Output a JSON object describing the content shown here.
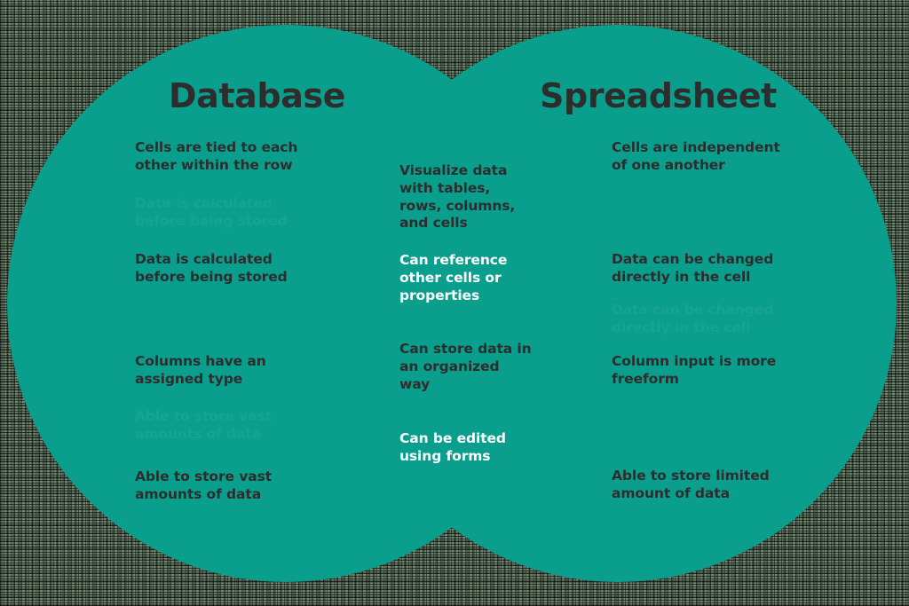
{
  "diagram": {
    "type": "venn",
    "circle_color": "#0a9e8d",
    "text_color_dark": "#2d2d2d",
    "text_color_light": "#ffffff",
    "left": {
      "heading": "Database",
      "items": [
        {
          "text": "Cells are tied to each other within the row",
          "style": "dark"
        },
        {
          "text": "Data is calculated before being stored",
          "style": "dark"
        },
        {
          "text": "Columns have an assigned type",
          "style": "dark"
        },
        {
          "text": "Able to store vast amounts of data",
          "style": "dark"
        }
      ],
      "ghost_items": [
        {
          "text": "Data is calculated before being stored"
        },
        {
          "text": "Able to store vast amounts of data"
        }
      ]
    },
    "center": {
      "items": [
        {
          "text": "Visualize data with tables, rows, columns, and cells",
          "style": "dark"
        },
        {
          "text": "Can reference other cells or properties",
          "style": "light"
        },
        {
          "text": "Can store data in an organized way",
          "style": "dark"
        },
        {
          "text": "Can be edited using forms",
          "style": "light"
        }
      ]
    },
    "right": {
      "heading": "Spreadsheet",
      "items": [
        {
          "text": "Cells are independent of one another",
          "style": "dark"
        },
        {
          "text": "Data can be changed directly in the cell",
          "style": "dark"
        },
        {
          "text": "Column input is more freeform",
          "style": "dark"
        },
        {
          "text": "Able to store limited amount of data",
          "style": "dark"
        }
      ],
      "ghost_items": [
        {
          "text": "Data can be changed directly in the cell"
        }
      ]
    }
  }
}
